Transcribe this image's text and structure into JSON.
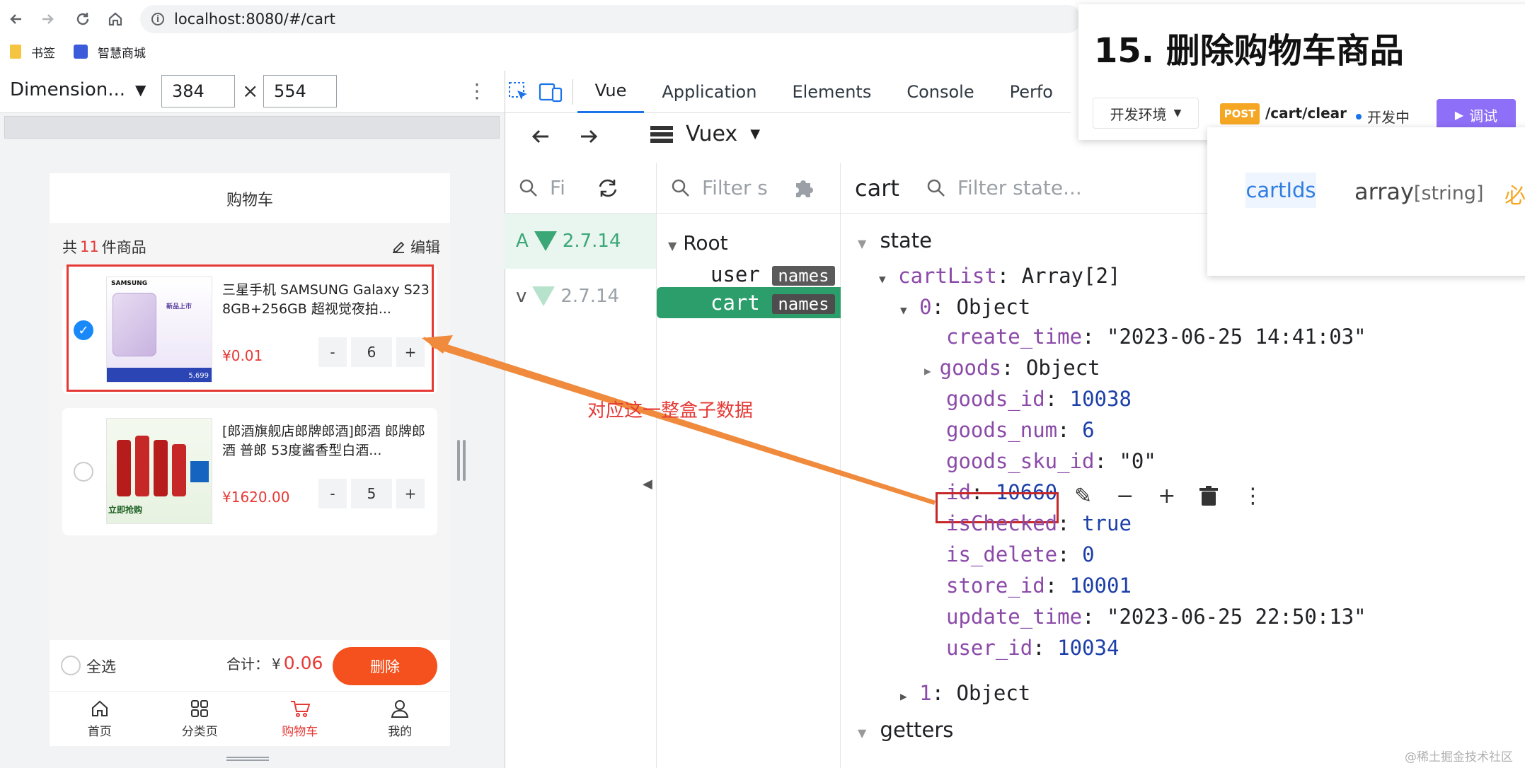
{
  "browser": {
    "url": "localhost:8080/#/cart",
    "bookmarks": [
      "书签",
      "智慧商城"
    ]
  },
  "device_toolbar": {
    "device": "Dimension...",
    "width": "384",
    "height": "554",
    "times": "×"
  },
  "cart_page": {
    "header": "购物车",
    "count_prefix": "共",
    "count": "11",
    "count_suffix": "件商品",
    "edit": "编辑",
    "items": [
      {
        "title": "三星手机 SAMSUNG Galaxy S23 8GB+256GB 超视觉夜拍...",
        "price": "¥0.01",
        "qty": "6",
        "checked": true,
        "brand": "SAMSUNG",
        "thumb_badge": "新品上市",
        "thumb_price": "5,699"
      },
      {
        "title": "[郎酒旗舰店郎牌郎酒]郎酒 郎牌郎酒 普郎 53度酱香型白酒...",
        "price": "¥1620.00",
        "qty": "5",
        "checked": false,
        "thumb_text": "立即抢购"
      }
    ],
    "minus": "-",
    "plus": "+",
    "select_all": "全选",
    "total_label": "合计：",
    "total_currency": "¥",
    "total": "0.06",
    "delete_btn": "删除",
    "tabs": [
      "首页",
      "分类页",
      "购物车",
      "我的"
    ]
  },
  "devtools": {
    "tabs": [
      "Vue",
      "Application",
      "Elements",
      "Console",
      "Perfo"
    ],
    "vuex_label": "Vuex",
    "filter_short": "Fi",
    "filter_s": "Filter s",
    "module_name": "cart",
    "filter_state": "Filter state...",
    "apps": [
      {
        "prefix": "A",
        "version": "2.7.14"
      },
      {
        "prefix": "v",
        "version": "2.7.14"
      }
    ],
    "tree": {
      "root": "Root",
      "modules": [
        {
          "name": "user",
          "badge": "names"
        },
        {
          "name": "cart",
          "badge": "names"
        }
      ]
    },
    "state_label": "state",
    "getters_label": "getters",
    "cartList_key": "cartList",
    "cartList_value": "Array[2]",
    "item0_key": "0",
    "item0_value": "Object",
    "item1_key": "1",
    "item1_value": "Object",
    "fields": [
      {
        "key": "create_time",
        "value": "\"2023-06-25 14:41:03\"",
        "type": "str"
      },
      {
        "key": "goods",
        "value": "Object",
        "type": "obj"
      },
      {
        "key": "goods_id",
        "value": "10038",
        "type": "num"
      },
      {
        "key": "goods_num",
        "value": "6",
        "type": "num"
      },
      {
        "key": "goods_sku_id",
        "value": "\"0\"",
        "type": "str"
      },
      {
        "key": "id",
        "value": "10660",
        "type": "num"
      },
      {
        "key": "isChecked",
        "value": "true",
        "type": "num"
      },
      {
        "key": "is_delete",
        "value": "0",
        "type": "num"
      },
      {
        "key": "store_id",
        "value": "10001",
        "type": "num"
      },
      {
        "key": "update_time",
        "value": "\"2023-06-25 22:50:13\"",
        "type": "str"
      },
      {
        "key": "user_id",
        "value": "10034",
        "type": "num"
      }
    ]
  },
  "overlay": {
    "title": "15. 删除购物车商品",
    "env": "开发环境",
    "method": "POST",
    "path": "/cart/clear",
    "status": "开发中",
    "debug": "调试",
    "param_name": "cartIds",
    "param_type": "array",
    "param_subtype": "[string]",
    "param_required": "必"
  },
  "annotation": "对应这一整盒子数据",
  "watermark": "@稀土掘金技术社区",
  "colors": {
    "accent": "#e53935",
    "vue_green": "#3ba776",
    "selected_row": "#2b9e6b",
    "devtools_blue": "#1a73e8",
    "post_badge": "#f5a623",
    "debug_btn": "#8e6ff7"
  }
}
